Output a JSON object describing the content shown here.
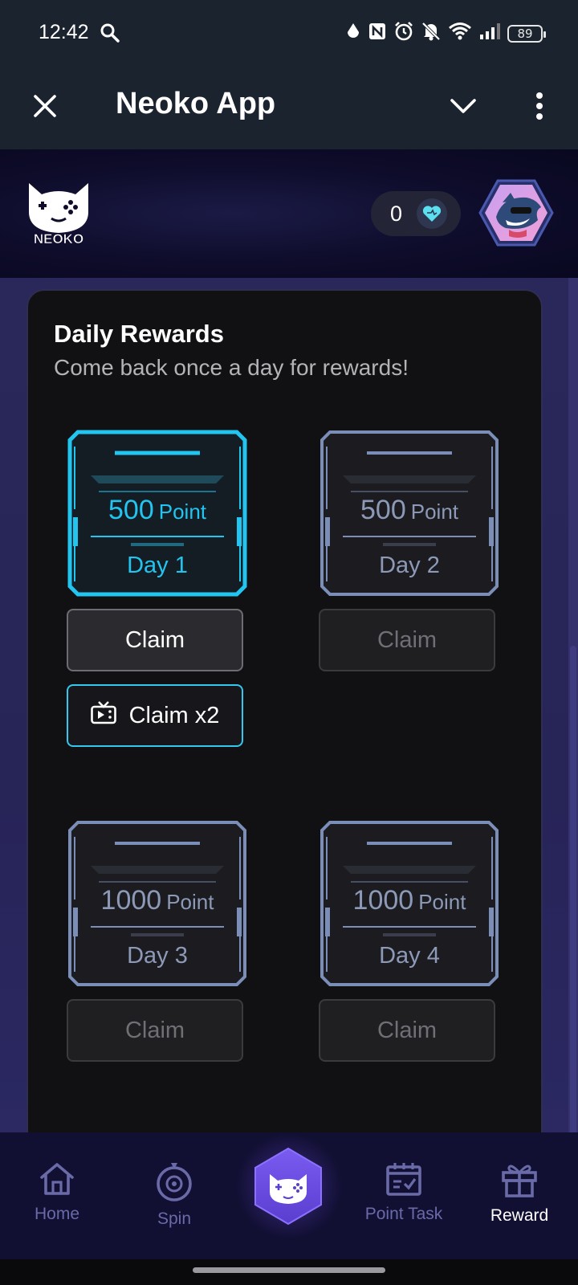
{
  "status_bar": {
    "time": "12:42",
    "battery": "89",
    "icons": [
      "search-icon",
      "data-saver-icon",
      "nfc-icon",
      "alarm-icon",
      "mute-icon",
      "wifi-icon",
      "signal-icon",
      "battery-icon"
    ]
  },
  "app_bar": {
    "title": "Neoko App",
    "close_icon": "close-icon",
    "collapse_icon": "chevron-down-icon",
    "menu_icon": "more-vertical-icon"
  },
  "header": {
    "logo_text": "NEOKO",
    "points": "0",
    "currency_icon": "heart-icon",
    "avatar": "shark-avatar"
  },
  "daily_rewards": {
    "title": "Daily Rewards",
    "subtitle": "Come back once a day for rewards!",
    "days": [
      {
        "amount": "500",
        "unit": "Point",
        "day": "Day 1",
        "claim_label": "Claim",
        "claimable": true,
        "double_label": "Claim x2"
      },
      {
        "amount": "500",
        "unit": "Point",
        "day": "Day 2",
        "claim_label": "Claim",
        "claimable": false
      },
      {
        "amount": "1000",
        "unit": "Point",
        "day": "Day 3",
        "claim_label": "Claim",
        "claimable": false
      },
      {
        "amount": "1000",
        "unit": "Point",
        "day": "Day 4",
        "claim_label": "Claim",
        "claimable": false
      }
    ]
  },
  "bottom_nav": {
    "items": [
      {
        "label": "Home",
        "icon": "home-icon",
        "active": false
      },
      {
        "label": "Spin",
        "icon": "spin-icon",
        "active": false
      },
      {
        "label": "",
        "icon": "game-cat-icon",
        "active": false
      },
      {
        "label": "Point Task",
        "icon": "calendar-check-icon",
        "active": false
      },
      {
        "label": "Reward",
        "icon": "gift-icon",
        "active": true
      }
    ]
  },
  "colors": {
    "accent": "#22c4f0",
    "nav_inactive": "#6a6aa8",
    "tile_inactive": "#8c9ab8",
    "center_button": "#6a4fe0"
  }
}
